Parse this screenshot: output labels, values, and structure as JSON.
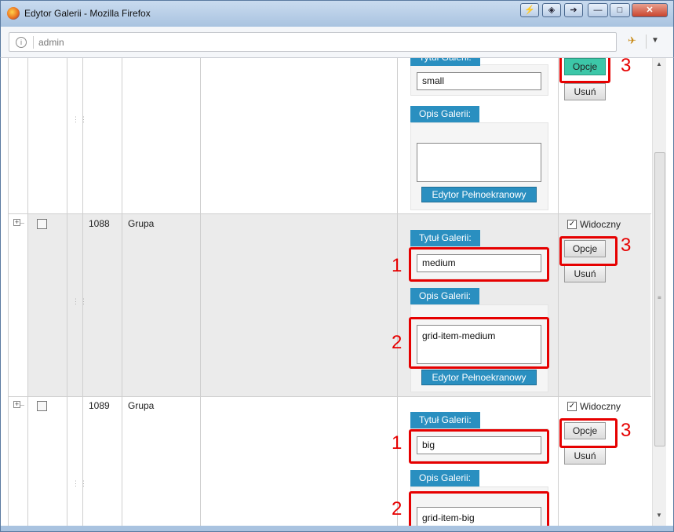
{
  "window": {
    "title": "Edytor Galerii - Mozilla Firefox",
    "close_glyph": "✕",
    "minimize_glyph": "—",
    "maximize_glyph": "□"
  },
  "urlbar": {
    "url": "admin"
  },
  "rows": [
    {
      "id": "",
      "type": "",
      "title_label": "Tytuł Galerii:",
      "title_value": "small",
      "desc_label": "Opis Galerii:",
      "desc_value": "",
      "editor_button": "Edytor Pełnoekranowy",
      "options_button": "Opcje",
      "delete_button": "Usuń"
    },
    {
      "id": "1088",
      "type": "Grupa",
      "visible_label": "Widoczny",
      "title_label": "Tytuł Galerii:",
      "title_value": "medium",
      "desc_label": "Opis Galerii:",
      "desc_value": "grid-item-medium",
      "editor_button": "Edytor Pełnoekranowy",
      "options_button": "Opcje",
      "delete_button": "Usuń"
    },
    {
      "id": "1089",
      "type": "Grupa",
      "visible_label": "Widoczny",
      "title_label": "Tytuł Galerii:",
      "title_value": "big",
      "desc_label": "Opis Galerii:",
      "desc_value": "grid-item-big",
      "options_button": "Opcje",
      "delete_button": "Usuń"
    }
  ],
  "annotations": {
    "n1": "1",
    "n2": "2",
    "n3": "3"
  },
  "colors": {
    "accent": "#2a8fc0",
    "highlight": "#e60000",
    "active_button": "#3cc7a8"
  }
}
